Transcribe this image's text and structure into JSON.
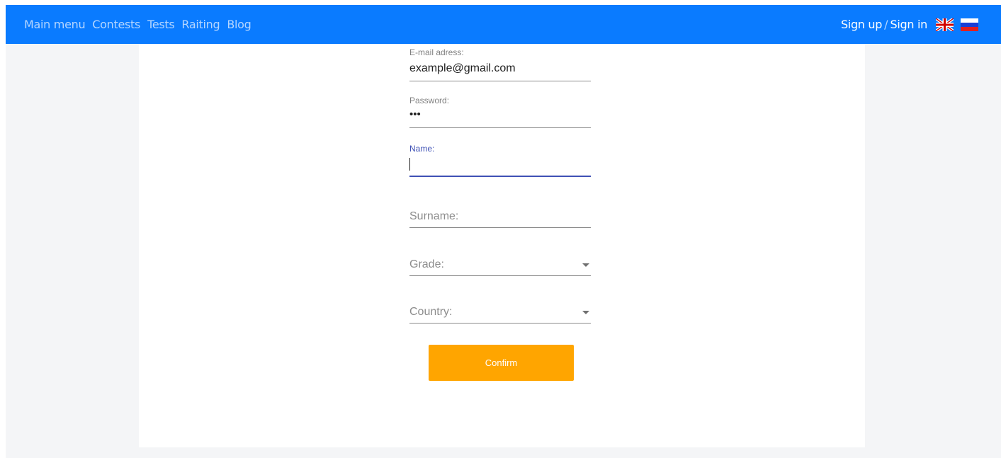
{
  "nav": {
    "links": [
      "Main menu",
      "Contests",
      "Tests",
      "Raiting",
      "Blog"
    ],
    "sign_up": "Sign up",
    "separator": "/",
    "sign_in": "Sign in",
    "languages": [
      "uk-flag-icon",
      "ru-flag-icon"
    ]
  },
  "form": {
    "email": {
      "label": "E-mail adress:",
      "value": "example@gmail.com"
    },
    "password": {
      "label": "Password:",
      "value": "•••"
    },
    "name": {
      "label": "Name:",
      "value": ""
    },
    "surname": {
      "placeholder": "Surname:"
    },
    "grade": {
      "placeholder": "Grade:"
    },
    "country": {
      "placeholder": "Country:"
    },
    "confirm_label": "Confirm"
  },
  "colors": {
    "navbar": "#0a7bff",
    "accent": "#3f51b5",
    "confirm": "#ffa500"
  }
}
